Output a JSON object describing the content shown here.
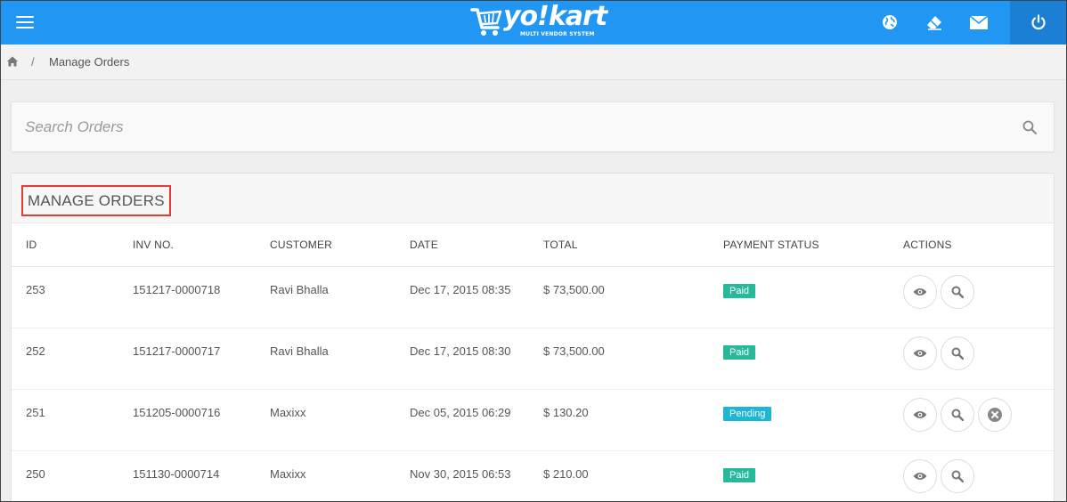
{
  "header": {
    "brand": "yo!kart",
    "tagline": "MULTI VENDOR SYSTEM",
    "accent_color": "#2196f3",
    "icons": [
      "menu-icon",
      "globe-icon",
      "eraser-icon",
      "mail-icon",
      "power-icon"
    ]
  },
  "breadcrumb": {
    "separator": "/",
    "current": "Manage Orders"
  },
  "search": {
    "placeholder": "Search Orders",
    "value": ""
  },
  "orders": {
    "title": "MANAGE ORDERS",
    "columns": {
      "id": "ID",
      "inv": "INV NO.",
      "customer": "CUSTOMER",
      "date": "DATE",
      "total": "TOTAL",
      "payment": "PAYMENT STATUS",
      "actions": "ACTIONS"
    },
    "rows": [
      {
        "id": "253",
        "inv": "151217-0000718",
        "customer": "Ravi Bhalla",
        "date": "Dec 17, 2015 08:35",
        "total": "$ 73,500.00",
        "status": "Paid",
        "status_color": "#26b99a",
        "cancel": false
      },
      {
        "id": "252",
        "inv": "151217-0000717",
        "customer": "Ravi Bhalla",
        "date": "Dec 17, 2015 08:30",
        "total": "$ 73,500.00",
        "status": "Paid",
        "status_color": "#26b99a",
        "cancel": false
      },
      {
        "id": "251",
        "inv": "151205-0000716",
        "customer": "Maxixx",
        "date": "Dec 05, 2015 06:29",
        "total": "$ 130.20",
        "status": "Pending",
        "status_color": "#1fb5d4",
        "cancel": true
      },
      {
        "id": "250",
        "inv": "151130-0000714",
        "customer": "Maxixx",
        "date": "Nov 30, 2015 06:53",
        "total": "$ 210.00",
        "status": "Paid",
        "status_color": "#26b99a",
        "cancel": false
      }
    ]
  }
}
